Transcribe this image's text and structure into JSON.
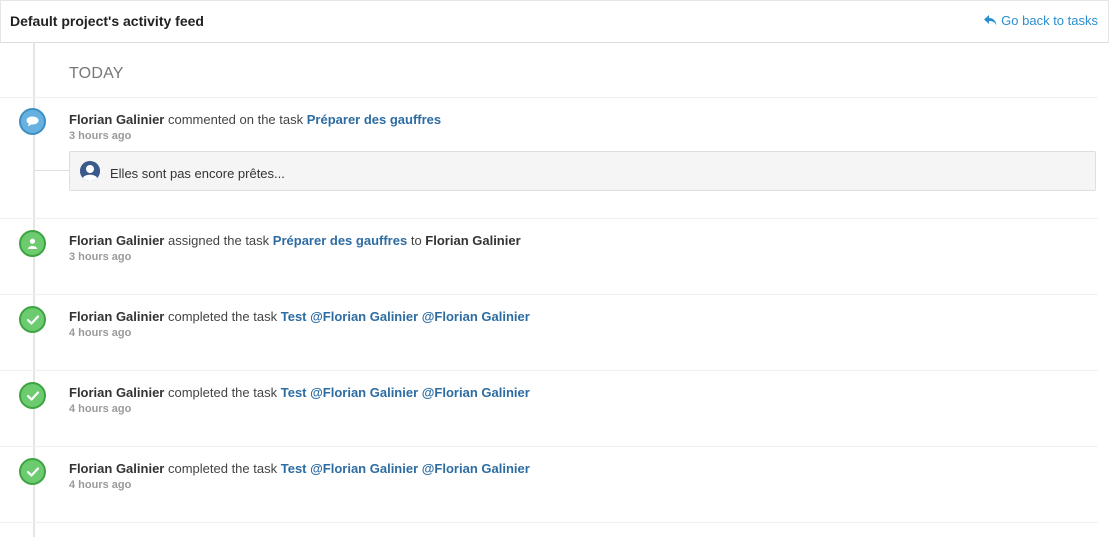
{
  "header": {
    "title": "Default project's activity feed",
    "back_label": "Go back to tasks"
  },
  "feed": {
    "day_label": "TODAY",
    "entries": [
      {
        "icon": "comment-icon",
        "actor": "Florian Galinier",
        "verb": "commented on the task",
        "task": "Préparer des gauffres",
        "time": "3 hours ago",
        "comment": "Elles sont pas encore prêtes..."
      },
      {
        "icon": "user-icon",
        "actor": "Florian Galinier",
        "verb": "assigned the task",
        "task": "Préparer des gauffres",
        "connector": "to",
        "target": "Florian Galinier",
        "time": "3 hours ago"
      },
      {
        "icon": "check-icon",
        "actor": "Florian Galinier",
        "verb": "completed the task",
        "task": "Test @Florian Galinier @Florian Galinier",
        "time": "4 hours ago"
      },
      {
        "icon": "check-icon",
        "actor": "Florian Galinier",
        "verb": "completed the task",
        "task": "Test @Florian Galinier @Florian Galinier",
        "time": "4 hours ago"
      },
      {
        "icon": "check-icon",
        "actor": "Florian Galinier",
        "verb": "completed the task",
        "task": "Test @Florian Galinier @Florian Galinier",
        "time": "4 hours ago"
      }
    ]
  },
  "colors": {
    "link": "#2d6ca2",
    "back_link": "#2a8fd1",
    "comment_badge": "#67b1e0",
    "success_badge": "#6ccb6f"
  }
}
